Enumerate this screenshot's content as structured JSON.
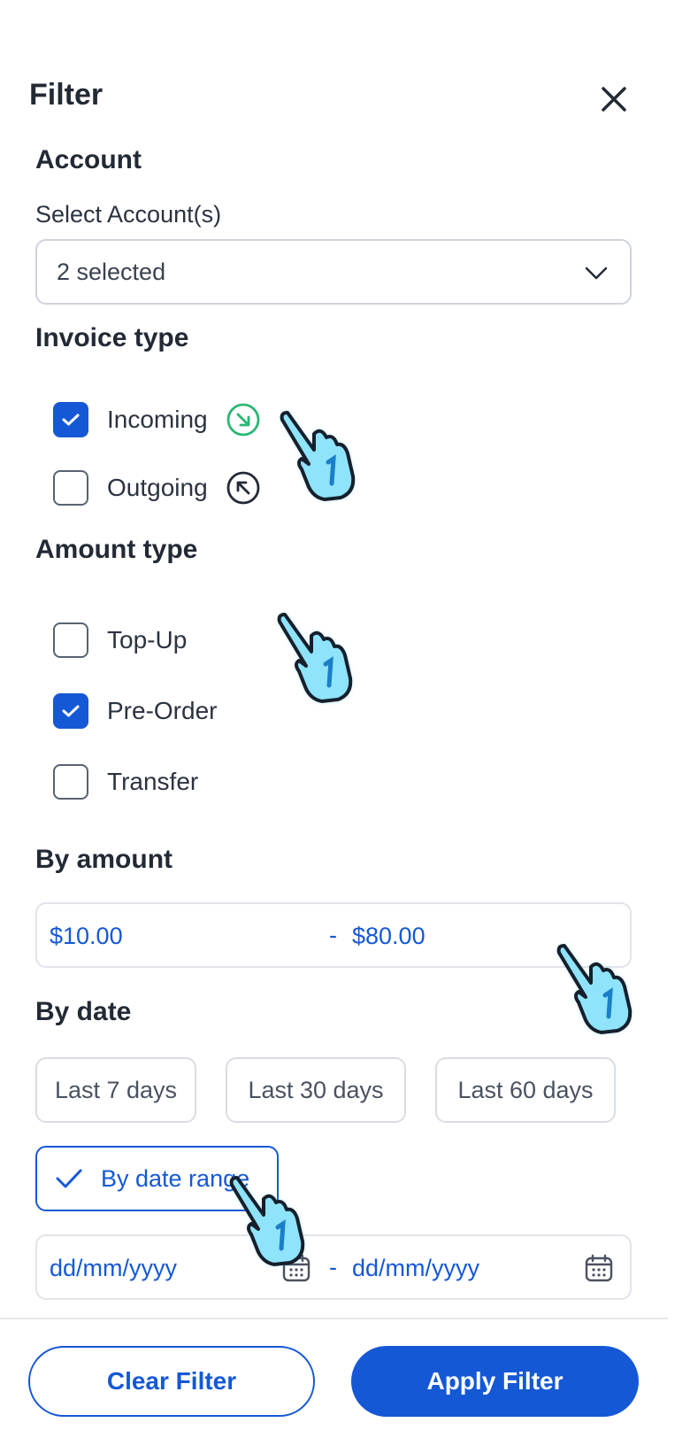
{
  "header": {
    "title": "Filter",
    "close_icon": "close-icon"
  },
  "account": {
    "section_title": "Account",
    "field_label": "Select Account(s)",
    "selected_value": "2 selected"
  },
  "invoice_type": {
    "section_title": "Invoice type",
    "options": [
      {
        "label": "Incoming",
        "checked": true,
        "icon": "arrow-down-right-circle-icon",
        "icon_color": "#2bb673"
      },
      {
        "label": "Outgoing",
        "checked": false,
        "icon": "arrow-up-left-circle-icon",
        "icon_color": "#232a35"
      }
    ]
  },
  "amount_type": {
    "section_title": "Amount type",
    "options": [
      {
        "label": "Top-Up",
        "checked": false
      },
      {
        "label": "Pre-Order",
        "checked": true
      },
      {
        "label": "Transfer",
        "checked": false
      }
    ]
  },
  "by_amount": {
    "section_title": "By amount",
    "min_value": "$10.00",
    "separator": "-",
    "max_value": "$80.00"
  },
  "by_date": {
    "section_title": "By date",
    "presets": [
      "Last 7 days",
      "Last 30 days",
      "Last 60 days"
    ],
    "range_toggle_label": "By date range",
    "range_toggle_checked": true,
    "start_placeholder": "dd/mm/yyyy",
    "separator": "-",
    "end_placeholder": "dd/mm/yyyy"
  },
  "footer": {
    "clear_label": "Clear Filter",
    "apply_label": "Apply Filter"
  },
  "colors": {
    "accent": "#1558d6",
    "border": "#cfd3db",
    "text": "#232a35",
    "cursor": "#4fd0f5"
  }
}
